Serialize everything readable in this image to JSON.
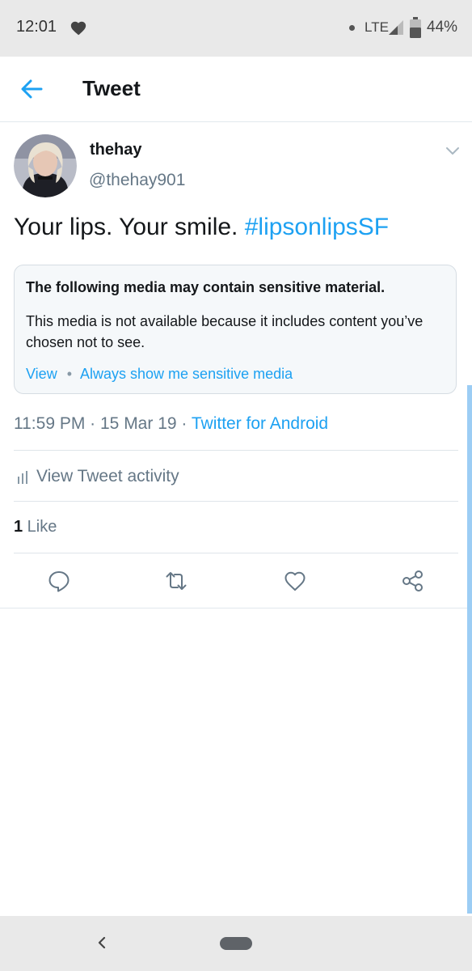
{
  "status_bar": {
    "time": "12:01",
    "network": "LTE",
    "battery": "44%",
    "icons": [
      "heart-icon",
      "signal-icon",
      "battery-icon"
    ]
  },
  "header": {
    "title": "Tweet",
    "back_icon": "arrow-left-icon"
  },
  "tweet": {
    "user_name": "thehay",
    "user_handle": "@thehay901",
    "text": "Your lips. Your smile. ",
    "hashtag": "#lipsonlipsSF",
    "sensitive_card": {
      "title": "The following media may contain sensitive material.",
      "body": "This media is not available because it includes content you’ve chosen not to see.",
      "view_label": "View",
      "separator": "•",
      "always_show_label": "Always show me sensitive media"
    },
    "meta": {
      "time": "11:59 PM",
      "sep": " · ",
      "date": "15 Mar 19",
      "source": "Twitter for Android"
    },
    "activity_label": "View Tweet activity",
    "likes": {
      "count": "1",
      "label": " Like"
    },
    "actions": [
      "reply-icon",
      "retweet-icon",
      "like-icon",
      "share-icon"
    ]
  },
  "colors": {
    "accent": "#1da1f2",
    "secondary_text": "#657786",
    "primary_text": "#14171a",
    "status_bar_bg": "#e9e9e9"
  }
}
